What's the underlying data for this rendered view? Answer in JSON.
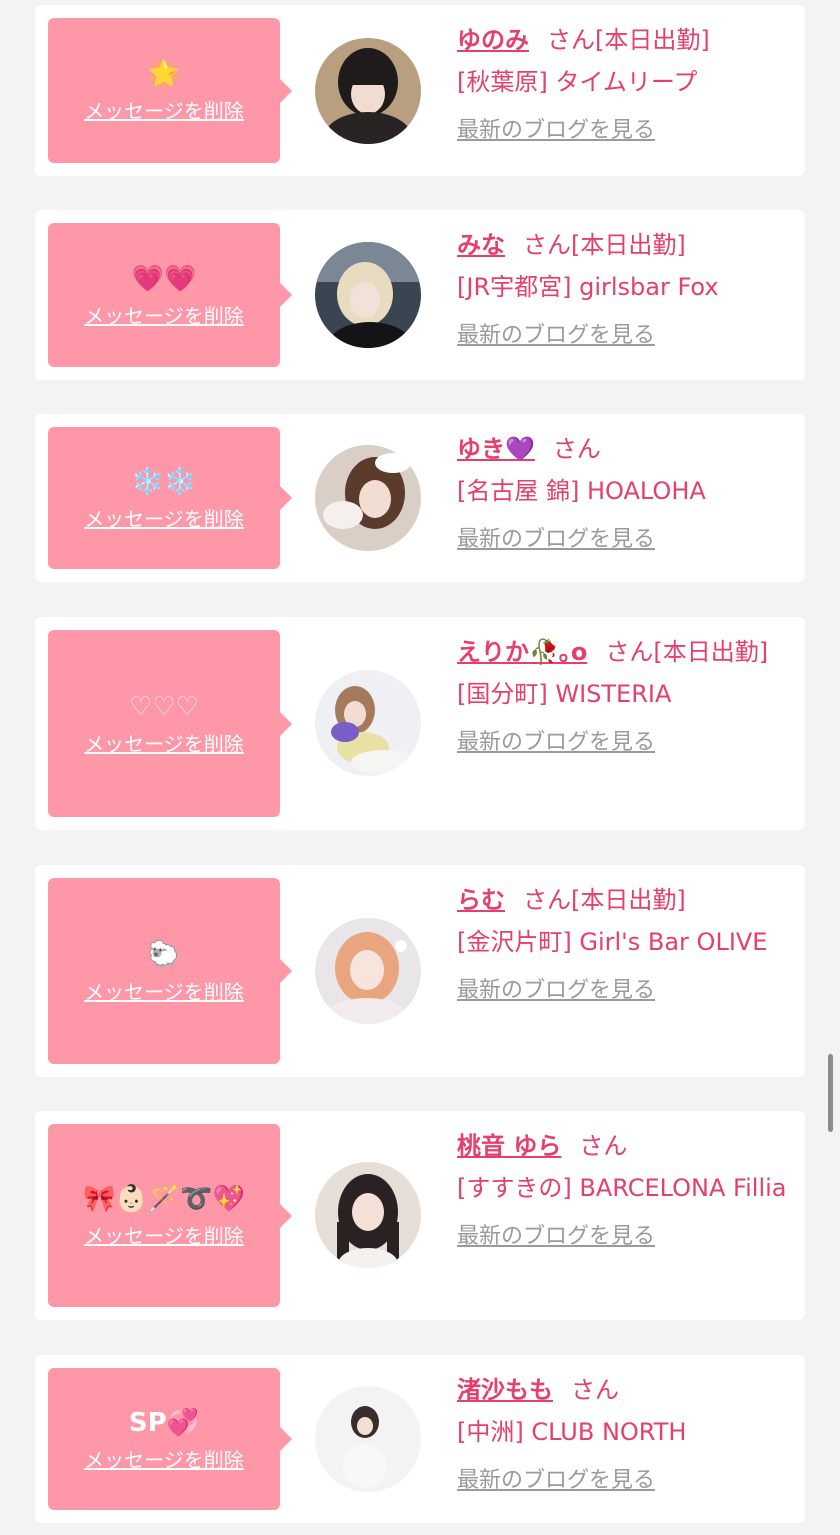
{
  "cards": [
    {
      "message": "🌟",
      "delete_label": "メッセージを削除",
      "name": "ゆのみ",
      "honorific": "さん",
      "status": "[本日出勤]",
      "shop": "[秋葉原] タイムリープ",
      "blog_label": "最新のブログを見る"
    },
    {
      "message": "💗💗",
      "delete_label": "メッセージを削除",
      "name": "みな",
      "honorific": "さん",
      "status": "[本日出勤]",
      "shop": "[JR宇都宮] girlsbar Fox",
      "blog_label": "最新のブログを見る"
    },
    {
      "message": "❄️❄️",
      "delete_label": "メッセージを削除",
      "name": "ゆき💜",
      "honorific": "さん",
      "status": "",
      "shop": "[名古屋 錦] HOALOHA",
      "blog_label": "最新のブログを見る"
    },
    {
      "message": "♡♡♡",
      "delete_label": "メッセージを削除",
      "name": "えりか🥀｡o",
      "honorific": "さん",
      "status": "[本日出勤]",
      "shop": "[国分町] WISTERIA",
      "blog_label": "最新のブログを見る"
    },
    {
      "message": "🐑",
      "delete_label": "メッセージを削除",
      "name": "らむ",
      "honorific": "さん",
      "status": "[本日出勤]",
      "shop": "[金沢片町] Girl's Bar OLIVE",
      "blog_label": "最新のブログを見る"
    },
    {
      "message": "🎀👶🏻🪄➰💖",
      "delete_label": "メッセージを削除",
      "name": "桃音 ゆら",
      "honorific": "さん",
      "status": "",
      "shop": "[すすきの] BARCELONA Fillia",
      "blog_label": "最新のブログを見る"
    },
    {
      "message": "SP💞",
      "delete_label": "メッセージを削除",
      "name": "渚沙もも",
      "honorific": "さん",
      "status": "",
      "shop": "[中洲] CLUB NORTH",
      "blog_label": "最新のブログを見る"
    }
  ]
}
